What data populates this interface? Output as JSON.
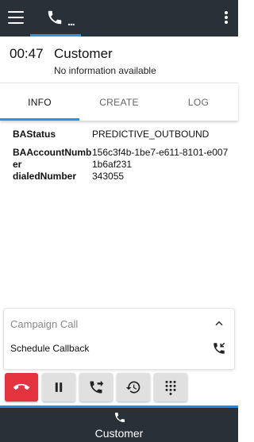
{
  "topbar": {
    "menu_icon": "hamburger-menu-icon",
    "phone_tab_icon": "phone-icon",
    "phone_tab_ellipsis": "...",
    "overflow_icon": "more-vertical-icon"
  },
  "call": {
    "timer": "00:47",
    "name": "Customer",
    "subtitle": "No information available"
  },
  "tabs": [
    {
      "label": "INFO",
      "active": true
    },
    {
      "label": "CREATE",
      "active": false
    },
    {
      "label": "LOG",
      "active": false
    }
  ],
  "info_rows": [
    {
      "key": "BAStatus",
      "value": "PREDICTIVE_OUTBOUND"
    },
    {
      "key": "BAAccountNumber",
      "value": "156c3f4b-1be7-e611-8101-e0071b6af231"
    },
    {
      "key": "dialedNumber",
      "value": "343055"
    }
  ],
  "campaign": {
    "title": "Campaign Call",
    "collapse_icon": "chevron-up-icon",
    "schedule_label": "Schedule Callback",
    "schedule_icon": "callback-phone-icon"
  },
  "controls": [
    {
      "name": "hangup-button",
      "icon": "phone-hangup-icon"
    },
    {
      "name": "hold-button",
      "icon": "pause-icon"
    },
    {
      "name": "transfer-button",
      "icon": "call-transfer-icon"
    },
    {
      "name": "history-button",
      "icon": "history-icon"
    },
    {
      "name": "dialpad-button",
      "icon": "dialpad-icon"
    }
  ],
  "colors": {
    "topbar_bg": "#2a3038",
    "accent": "#2196f3",
    "hangup": "#e2333f"
  },
  "bottom_bar": {
    "icon": "phone-icon",
    "label": "Customer"
  }
}
